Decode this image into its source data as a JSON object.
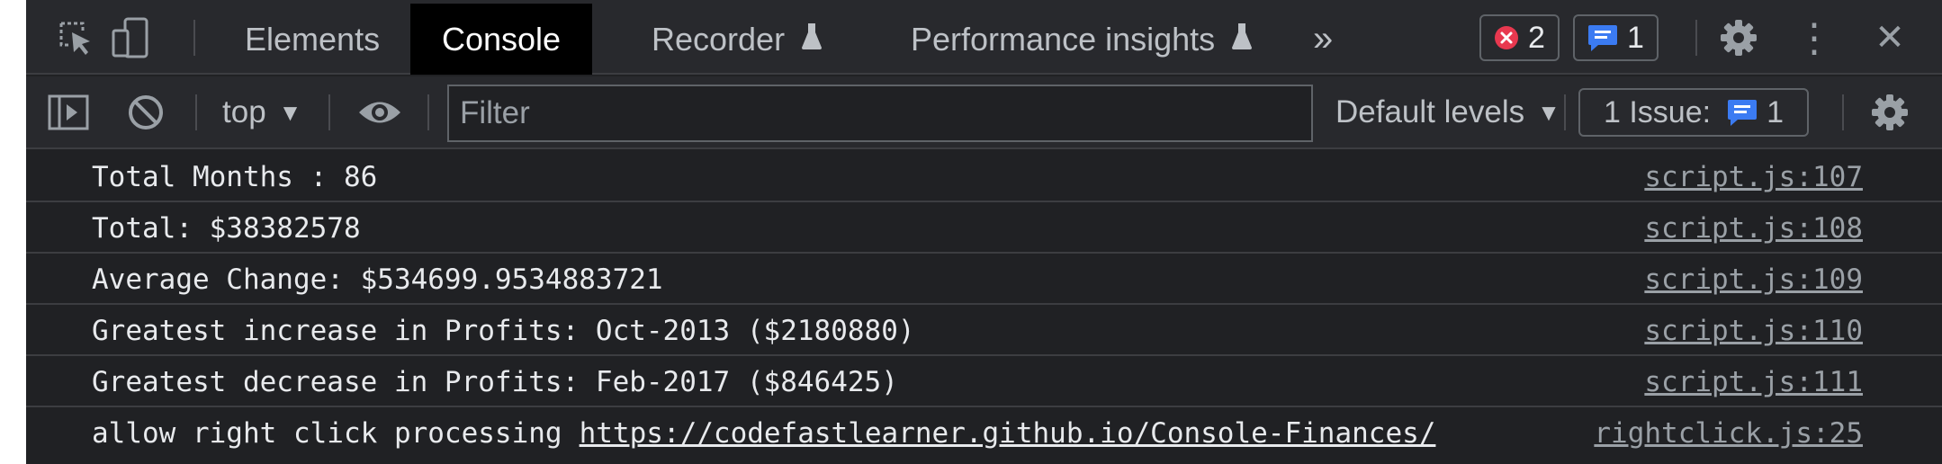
{
  "tabbar": {
    "tabs": [
      {
        "label": "Elements"
      },
      {
        "label": "Console"
      },
      {
        "label": "Recorder"
      },
      {
        "label": "Performance insights"
      }
    ],
    "more_glyph": "»",
    "error_count": "2",
    "message_count": "1",
    "more_options_glyph": "⋮",
    "close_glyph": "✕"
  },
  "toolbar": {
    "context": "top",
    "filter_placeholder": "Filter",
    "levels": "Default levels",
    "issues_label": "1 Issue:",
    "issues_count": "1"
  },
  "console": {
    "messages": [
      {
        "text": "Total Months : 86",
        "source": "script.js:107"
      },
      {
        "text": "Total: $38382578",
        "source": "script.js:108"
      },
      {
        "text": "Average Change: $534699.9534883721",
        "source": "script.js:109"
      },
      {
        "text": "Greatest increase in Profits: Oct-2013 ($2180880)",
        "source": "script.js:110"
      },
      {
        "text": "Greatest decrease in Profits: Feb-2017 ($846425)",
        "source": "script.js:111"
      },
      {
        "text": "allow right click processing",
        "link": "https://codefastlearner.github.io/Console-Finances/",
        "source": "rightclick.js:25"
      }
    ]
  },
  "colors": {
    "panel_bg": "#202124",
    "toolbar_bg": "#28292d",
    "error_red": "#e8384f",
    "message_blue": "#3b7bf2"
  },
  "icons": [
    "inspect-element-icon",
    "device-toolbar-icon",
    "flask-icon",
    "error-icon",
    "message-icon",
    "gear-icon",
    "more-options-icon",
    "close-icon",
    "sidebar-toggle-icon",
    "clear-console-icon",
    "eye-icon"
  ]
}
